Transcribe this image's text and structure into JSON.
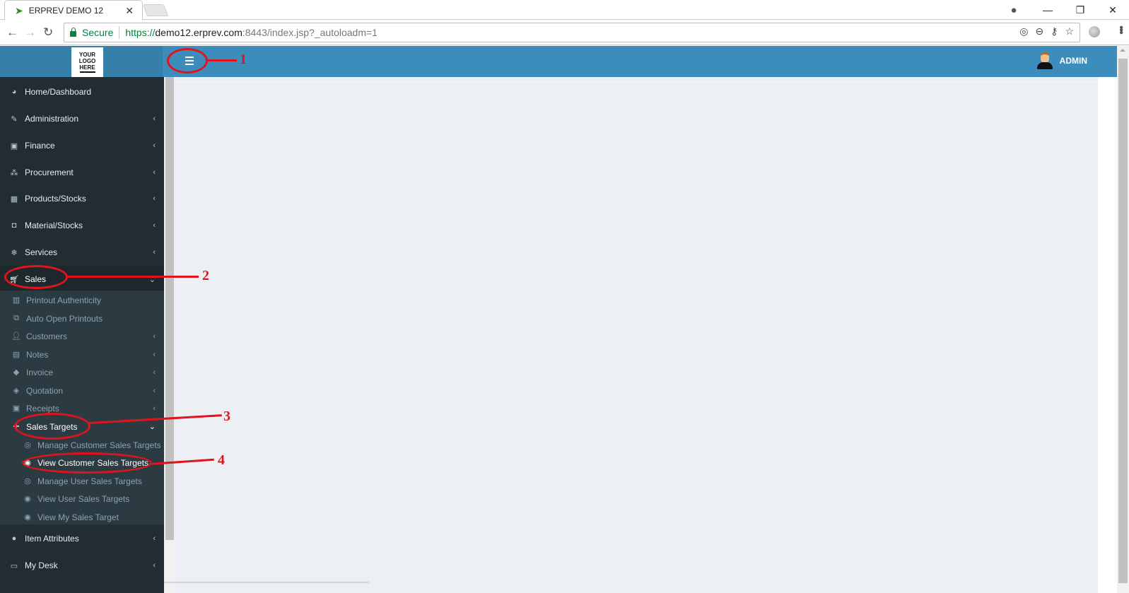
{
  "browser": {
    "tab_title": "ERPREV DEMO 12",
    "secure_label": "Secure",
    "url_scheme": "https://",
    "url_host": "demo12.erprev.com",
    "url_port": ":8443",
    "url_path": "/index.jsp?_autoloadm=1"
  },
  "header": {
    "logo_lines": [
      "YOUR",
      "LOGO",
      "HERE"
    ],
    "username": "ADMIN",
    "brand_color": "#3c8dbc"
  },
  "sidebar": {
    "items": [
      {
        "label": "Home/Dashboard",
        "icon": "dashboard-icon"
      },
      {
        "label": "Administration",
        "icon": "wrench-icon"
      },
      {
        "label": "Finance",
        "icon": "money-icon"
      },
      {
        "label": "Procurement",
        "icon": "cubes-icon"
      },
      {
        "label": "Products/Stocks",
        "icon": "building-icon"
      },
      {
        "label": "Material/Stocks",
        "icon": "bucket-icon"
      },
      {
        "label": "Services",
        "icon": "snowflake-icon"
      },
      {
        "label": "Sales",
        "icon": "cart-icon"
      }
    ],
    "sales_submenu": [
      {
        "label": "Printout Authenticity",
        "icon": "barcode-icon"
      },
      {
        "label": "Auto Open Printouts",
        "icon": "external-link-icon"
      },
      {
        "label": "Customers",
        "icon": "user-icon"
      },
      {
        "label": "Notes",
        "icon": "file-text-icon"
      },
      {
        "label": "Invoice",
        "icon": "tag-icon"
      },
      {
        "label": "Quotation",
        "icon": "tags-icon"
      },
      {
        "label": "Receipts",
        "icon": "money-icon"
      },
      {
        "label": "Sales Targets",
        "icon": "crosshairs-icon"
      }
    ],
    "sales_targets_submenu": [
      {
        "label": "Manage Customer Sales Targets",
        "icon": "bullseye-icon"
      },
      {
        "label": "View Customer Sales Targets",
        "icon": "dot-circle-icon"
      },
      {
        "label": "Manage User Sales Targets",
        "icon": "bullseye-icon"
      },
      {
        "label": "View User Sales Targets",
        "icon": "dot-circle-icon"
      },
      {
        "label": "View My Sales Target",
        "icon": "dot-circle-icon"
      }
    ],
    "bottom_items": [
      {
        "label": "Item Attributes",
        "icon": "spotify-icon"
      },
      {
        "label": "My Desk",
        "icon": "desktop-icon"
      }
    ]
  },
  "annotations": [
    "1",
    "2",
    "3",
    "4"
  ]
}
